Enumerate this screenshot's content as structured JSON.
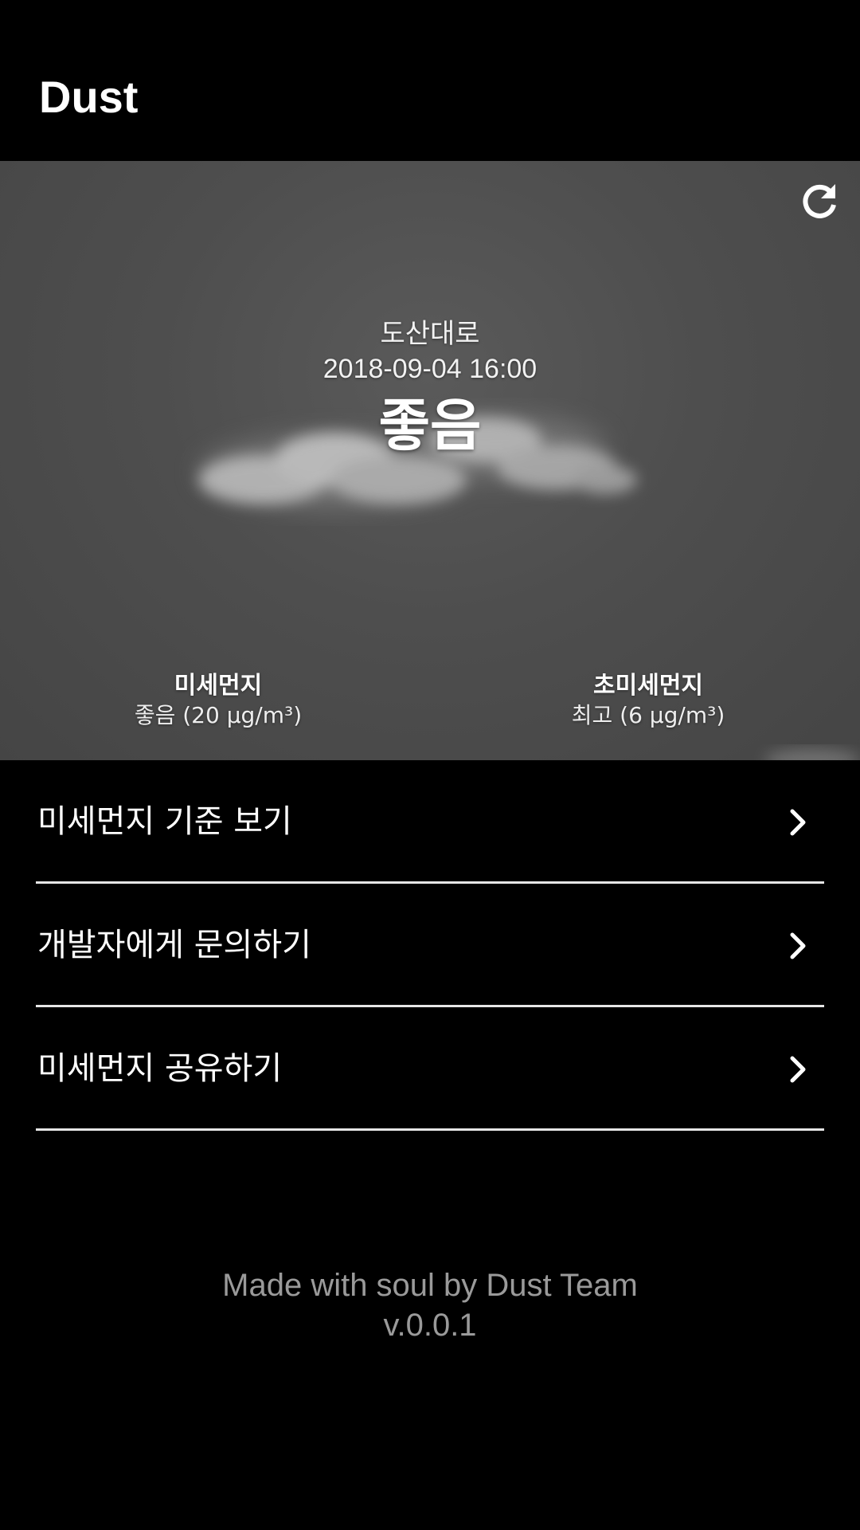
{
  "app_bar": {
    "title": "Dust"
  },
  "hero": {
    "refresh_icon": "refresh-icon",
    "location": "도산대로",
    "timestamp": "2018-09-04 16:00",
    "status": "좋음",
    "metrics": [
      {
        "label": "미세먼지",
        "value": "좋음 (20 μg/m³)"
      },
      {
        "label": "초미세먼지",
        "value": "최고 (6 μg/m³)"
      }
    ]
  },
  "menu": {
    "items": [
      {
        "label": "미세먼지 기준 보기",
        "icon": "chevron-right-icon"
      },
      {
        "label": "개발자에게 문의하기",
        "icon": "chevron-right-icon"
      },
      {
        "label": "미세먼지 공유하기",
        "icon": "chevron-right-icon"
      }
    ]
  },
  "footer": {
    "credit": "Made with soul by Dust Team",
    "version": "v.0.0.1"
  },
  "colors": {
    "background": "#000000",
    "hero_background": "#4e4e4e",
    "divider": "#e6e6e6",
    "footer_text": "#9a9a9a"
  }
}
